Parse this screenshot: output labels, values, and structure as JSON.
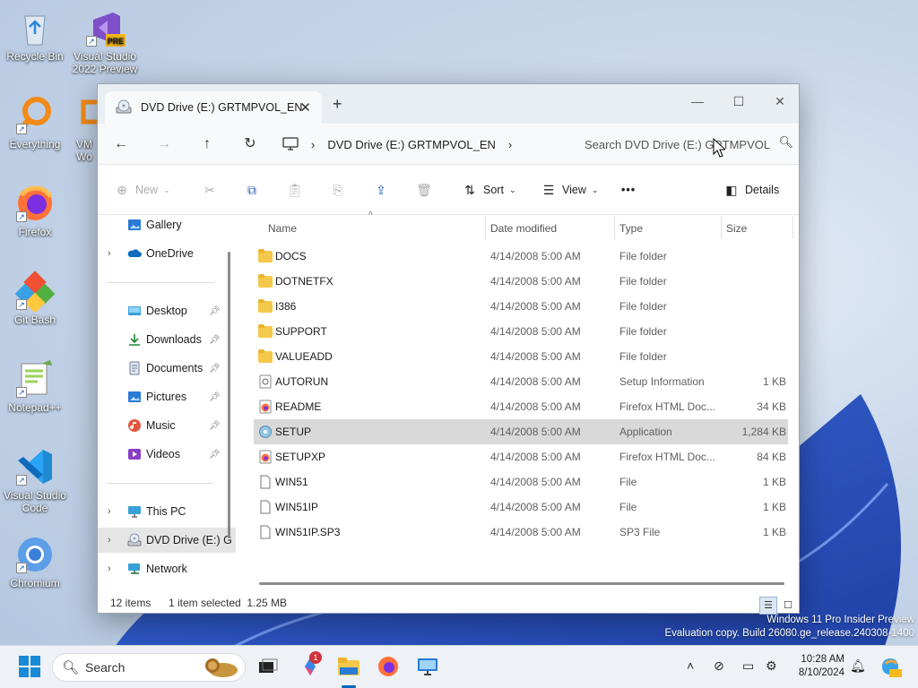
{
  "desktop": {
    "icons": [
      {
        "label": "Recycle Bin",
        "icon": "recycle-bin-icon"
      },
      {
        "label": "Visual Studio 2022 Preview",
        "icon": "visual-studio-icon",
        "badge": "PRE"
      },
      {
        "label": "Everything",
        "icon": "everything-search-icon"
      },
      {
        "label": "VM Wo",
        "icon": "vmware-icon"
      },
      {
        "label": "Firefox",
        "icon": "firefox-icon"
      },
      {
        "label": "Git Bash",
        "icon": "git-bash-icon"
      },
      {
        "label": "Notepad++",
        "icon": "notepad-plus-plus-icon"
      },
      {
        "label": "Visual Studio Code",
        "icon": "vscode-icon"
      },
      {
        "label": "Chromium",
        "icon": "chromium-icon"
      }
    ]
  },
  "window": {
    "tab_title": "DVD Drive (E:) GRTMPVOL_EN",
    "controls": {
      "minimize": "—",
      "maximize": "☐",
      "close": "✕"
    },
    "breadcrumb": "DVD Drive (E:) GRTMPVOL_EN",
    "search_placeholder": "Search DVD Drive (E:) GRTMPVOL",
    "commands": {
      "new": "New",
      "sort": "Sort",
      "view": "View",
      "more": "•••",
      "details": "Details"
    }
  },
  "sidebar": {
    "items": [
      {
        "label": "Gallery",
        "icon": "gallery-icon"
      },
      {
        "label": "OneDrive",
        "icon": "onedrive-icon"
      },
      {
        "label": "Desktop",
        "icon": "desktop-folder-icon"
      },
      {
        "label": "Downloads",
        "icon": "downloads-icon"
      },
      {
        "label": "Documents",
        "icon": "documents-icon"
      },
      {
        "label": "Pictures",
        "icon": "pictures-icon"
      },
      {
        "label": "Music",
        "icon": "music-icon"
      },
      {
        "label": "Videos",
        "icon": "videos-icon"
      },
      {
        "label": "This PC",
        "icon": "this-pc-icon"
      },
      {
        "label": "DVD Drive (E:) G",
        "icon": "dvd-drive-icon"
      },
      {
        "label": "Network",
        "icon": "network-icon"
      }
    ]
  },
  "columns": {
    "name": "Name",
    "date": "Date modified",
    "type": "Type",
    "size": "Size"
  },
  "files": [
    {
      "name": "DOCS",
      "date": "4/14/2008 5:00 AM",
      "type": "File folder",
      "size": "",
      "icon": "folder"
    },
    {
      "name": "DOTNETFX",
      "date": "4/14/2008 5:00 AM",
      "type": "File folder",
      "size": "",
      "icon": "folder"
    },
    {
      "name": "I386",
      "date": "4/14/2008 5:00 AM",
      "type": "File folder",
      "size": "",
      "icon": "folder"
    },
    {
      "name": "SUPPORT",
      "date": "4/14/2008 5:00 AM",
      "type": "File folder",
      "size": "",
      "icon": "folder"
    },
    {
      "name": "VALUEADD",
      "date": "4/14/2008 5:00 AM",
      "type": "File folder",
      "size": "",
      "icon": "folder"
    },
    {
      "name": "AUTORUN",
      "date": "4/14/2008 5:00 AM",
      "type": "Setup Information",
      "size": "1 KB",
      "icon": "setup-info"
    },
    {
      "name": "README",
      "date": "4/14/2008 5:00 AM",
      "type": "Firefox HTML Doc...",
      "size": "34 KB",
      "icon": "html"
    },
    {
      "name": "SETUP",
      "date": "4/14/2008 5:00 AM",
      "type": "Application",
      "size": "1,284 KB",
      "icon": "app"
    },
    {
      "name": "SETUPXP",
      "date": "4/14/2008 5:00 AM",
      "type": "Firefox HTML Doc...",
      "size": "84 KB",
      "icon": "html"
    },
    {
      "name": "WIN51",
      "date": "4/14/2008 5:00 AM",
      "type": "File",
      "size": "1 KB",
      "icon": "file"
    },
    {
      "name": "WIN51IP",
      "date": "4/14/2008 5:00 AM",
      "type": "File",
      "size": "1 KB",
      "icon": "file"
    },
    {
      "name": "WIN51IP.SP3",
      "date": "4/14/2008 5:00 AM",
      "type": "SP3 File",
      "size": "1 KB",
      "icon": "file"
    }
  ],
  "selected_file": "SETUP",
  "status": {
    "count": "12 items",
    "selection": "1 item selected  1.25 MB"
  },
  "watermark": {
    "line1": "Windows 11 Pro Insider Preview",
    "line2": "Evaluation copy. Build 26080.ge_release.240308-1400"
  },
  "taskbar": {
    "search_placeholder": "Search",
    "time": "10:28 AM",
    "date": "8/10/2024",
    "notification_badge": "1"
  },
  "colors": {
    "accent": "#0067c0",
    "selection": "#d9d9d9",
    "folder": "#f4c84a"
  }
}
